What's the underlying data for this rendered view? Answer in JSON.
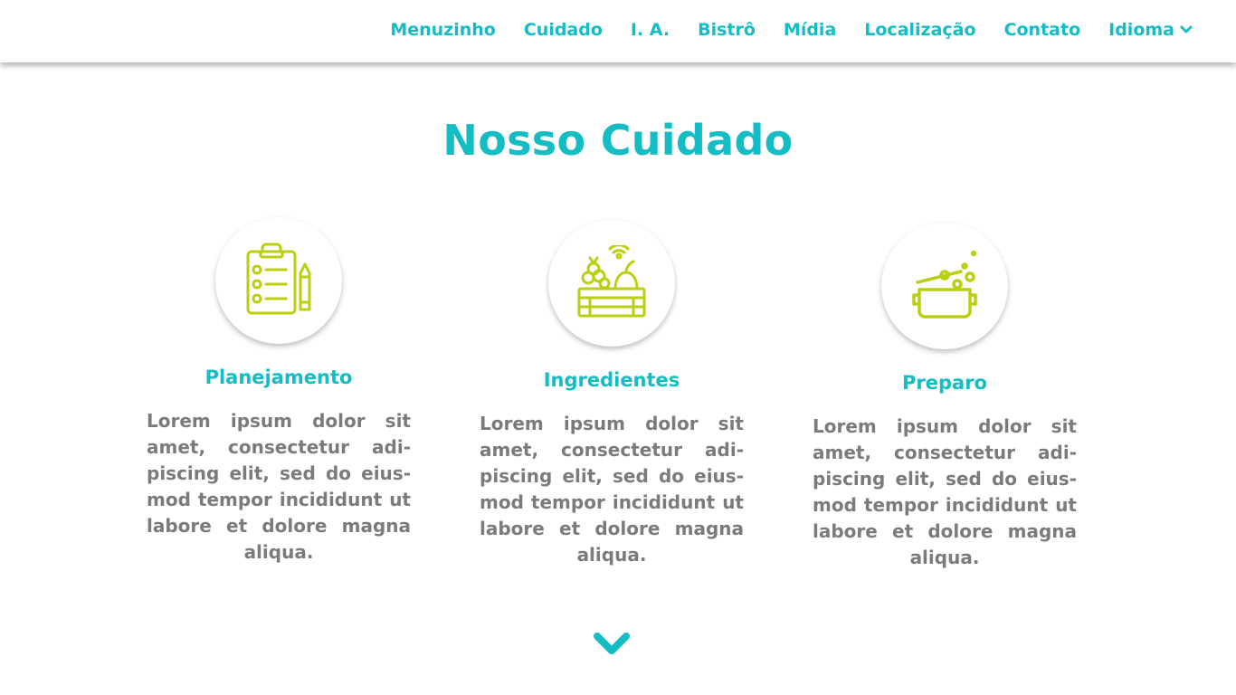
{
  "nav": {
    "items": [
      {
        "label": "Menuzinho"
      },
      {
        "label": "Cuidado"
      },
      {
        "label": "I. A."
      },
      {
        "label": "Bistrô"
      },
      {
        "label": "Mídia"
      },
      {
        "label": "Localização"
      },
      {
        "label": "Contato"
      },
      {
        "label": "Idioma",
        "icon": "chevron-down-icon"
      }
    ]
  },
  "section": {
    "title": "Nosso Cuidado"
  },
  "cards": [
    {
      "title": "Planejamento",
      "icon": "clipboard-checklist-icon",
      "text": "Lorem ipsum dolor sit amet, consectetur adi­piscing elit, sed do eius­mod tempor incididunt ut labore et dolore magna aliqua."
    },
    {
      "title": "Ingredientes",
      "icon": "produce-crate-icon",
      "text": "Lorem ipsum dolor sit amet, consectetur adi­piscing elit, sed do eius­mod tempor incididunt ut labore et dolore magna aliqua."
    },
    {
      "title": "Preparo",
      "icon": "cooking-pot-icon",
      "text": "Lorem ipsum dolor sit amet, consectetur adi­piscing elit, sed do eius­mod tempor incididunt ut labore et dolore magna aliqua."
    }
  ],
  "scroll_icon": "chevron-down-icon",
  "colors": {
    "accent": "#14bcc4",
    "icon": "#b9cf10",
    "body_text": "#7b7b7b"
  }
}
